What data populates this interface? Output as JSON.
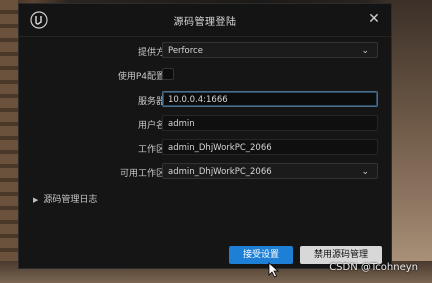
{
  "dialog": {
    "title": "源码管理登陆",
    "close_symbol": "✕"
  },
  "fields": {
    "provider": {
      "label": "提供方",
      "value": "Perforce"
    },
    "use_p4_config": {
      "label": "使用P4配置",
      "checked": false
    },
    "server": {
      "label": "服务器",
      "value": "10.0.0.4:1666"
    },
    "username": {
      "label": "用户名",
      "value": "admin"
    },
    "workspace": {
      "label": "工作区",
      "value": "admin_DhjWorkPC_2066"
    },
    "available_workspace": {
      "label": "可用工作区",
      "value": "admin_DhjWorkPC_2066"
    }
  },
  "log_section": {
    "label": "源码管理日志"
  },
  "buttons": {
    "accept": "接受设置",
    "disable": "禁用源码管理"
  },
  "watermark": "CSDN @Tcohneyn",
  "colors": {
    "dialog_bg": "#151515",
    "primary_button": "#1e7fd6",
    "secondary_button": "#d8d8d8",
    "active_border": "#4a6f8c"
  }
}
